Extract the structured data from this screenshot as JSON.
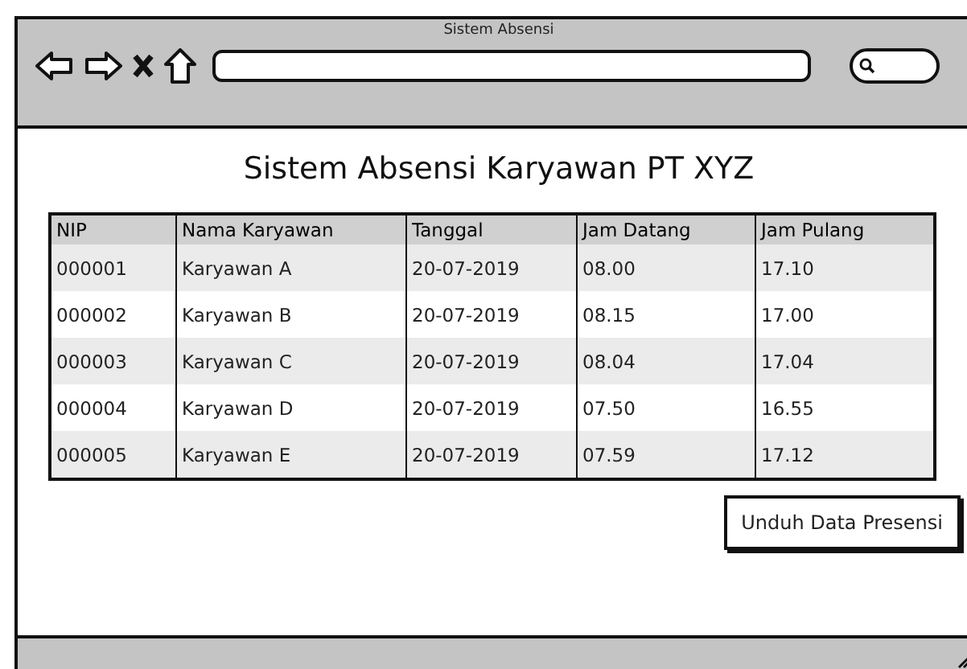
{
  "window": {
    "title": "Sistem Absensi"
  },
  "heading": "Sistem Absensi Karyawan PT XYZ",
  "table": {
    "columns": [
      "NIP",
      "Nama Karyawan",
      "Tanggal",
      "Jam Datang",
      "Jam Pulang"
    ],
    "rows": [
      [
        "000001",
        "Karyawan A",
        "20-07-2019",
        "08.00",
        "17.10"
      ],
      [
        "000002",
        "Karyawan B",
        "20-07-2019",
        "08.15",
        "17.00"
      ],
      [
        "000003",
        "Karyawan C",
        "20-07-2019",
        "08.04",
        "17.04"
      ],
      [
        "000004",
        "Karyawan D",
        "20-07-2019",
        "07.50",
        "16.55"
      ],
      [
        "000005",
        "Karyawan E",
        "20-07-2019",
        "07.59",
        "17.12"
      ]
    ]
  },
  "buttons": [
    "Unduh Data Presensi"
  ]
}
